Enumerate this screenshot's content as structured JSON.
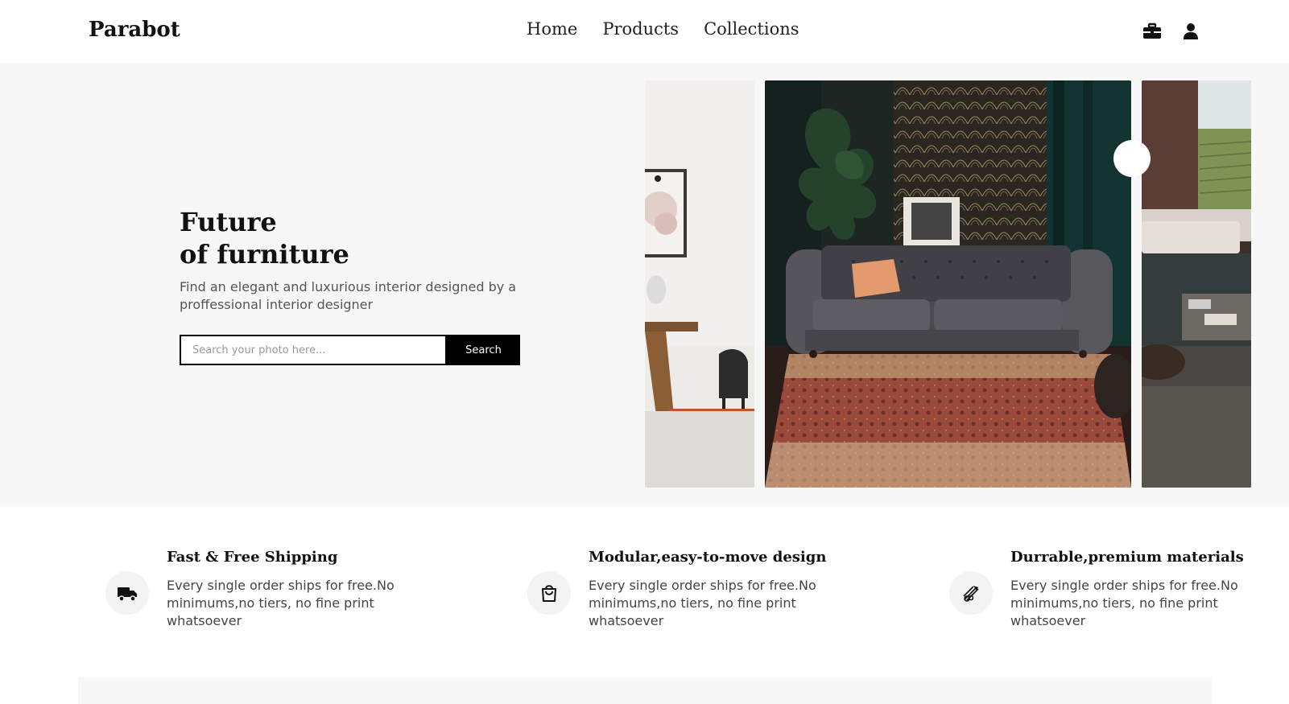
{
  "header": {
    "logo": "Parabot",
    "nav": [
      "Home",
      "Products",
      "Collections"
    ],
    "icons": [
      "briefcase-icon",
      "user-icon"
    ]
  },
  "hero": {
    "title_line1": "Future",
    "title_line2": "of furniture",
    "subtitle": "Find an elegant and luxurious interior designed by a proffessional interior designer",
    "search": {
      "placeholder": "Search your photo here...",
      "value": "",
      "button": "Search"
    }
  },
  "features": [
    {
      "icon": "truck-icon",
      "title": "Fast & Free Shipping",
      "text": "Every single order ships for free.No minimums,no tiers, no fine print whatsoever"
    },
    {
      "icon": "shopping-bag-icon",
      "title": "Modular,easy-to-move design",
      "text": "Every single order ships for free.No minimums,no tiers, no fine print whatsoever"
    },
    {
      "icon": "materials-icon",
      "title": "Durrable,premium materials",
      "text": "Every single order ships for free.No minimums,no tiers, no fine print whatsoever"
    }
  ],
  "colors": {
    "accent": "#000000",
    "hero_bg": "#f7f7f7",
    "icon_circle": "#f3f3f3"
  }
}
